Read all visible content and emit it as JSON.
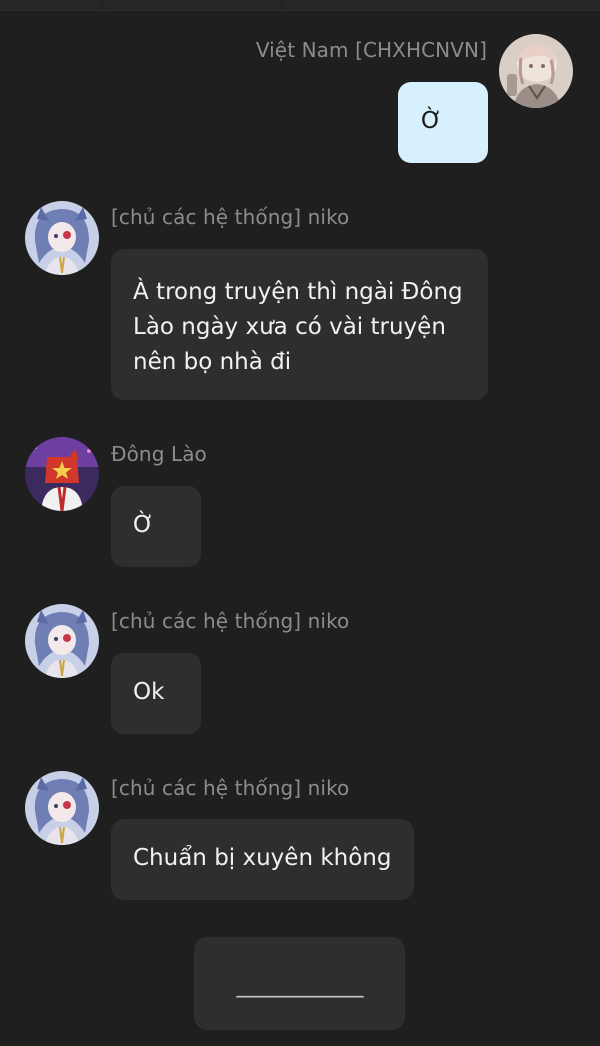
{
  "chat": {
    "messages": [
      {
        "sender": "Việt Nam [CHXHCNVN]",
        "text": "Ờ",
        "side": "right",
        "avatar_icon": "vietnam-avatar-icon"
      },
      {
        "sender": "[chủ các hệ thống] niko",
        "text": "À trong truyện thì ngài Đông Lào ngày xưa có vài truyện nên bọ nhà đi",
        "side": "left",
        "avatar_icon": "niko-avatar-icon"
      },
      {
        "sender": "Đông Lào",
        "text": "Ờ",
        "side": "left",
        "avatar_icon": "dong-lao-avatar-icon"
      },
      {
        "sender": "[chủ các hệ thống] niko",
        "text": "Ok",
        "side": "left",
        "avatar_icon": "niko-avatar-icon"
      },
      {
        "sender": "[chủ các hệ thống] niko",
        "text": "Chuẩn bị xuyên không",
        "side": "left",
        "avatar_icon": "niko-avatar-icon"
      }
    ],
    "footer_box": {
      "text": "____________"
    }
  },
  "colors": {
    "background": "#1f1f1f",
    "bubble_other": "#2e2e2e",
    "bubble_mine": "#d6f0fd",
    "sender_name": "#8c8c8c",
    "text_other": "#f1f1f1"
  }
}
